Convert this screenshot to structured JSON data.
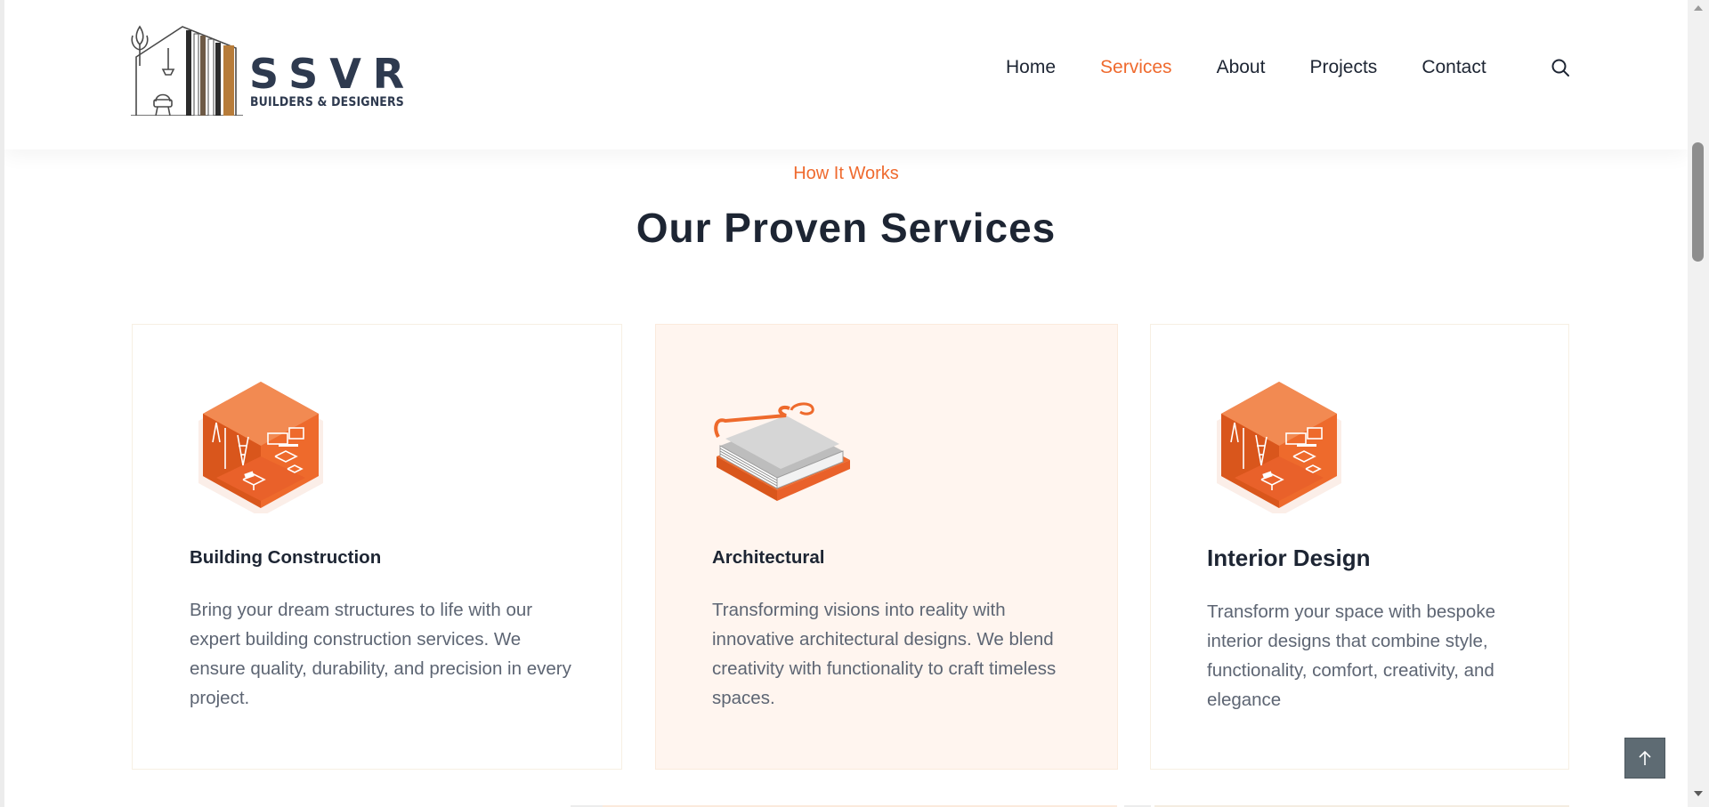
{
  "brand": {
    "name": "SSVR",
    "tagline": "BUILDERS & DESIGNERS",
    "colors": {
      "accent": "#ef6a2e",
      "text": "#1d2533",
      "muted": "#5d6573",
      "highlight_bg": "#fff5ef",
      "logo_brown": "#b77c3a"
    }
  },
  "nav": {
    "items": [
      {
        "label": "Home",
        "active": false
      },
      {
        "label": "Services",
        "active": true
      },
      {
        "label": "About",
        "active": false
      },
      {
        "label": "Projects",
        "active": false
      },
      {
        "label": "Contact",
        "active": false
      }
    ],
    "search_icon": "search-icon"
  },
  "section": {
    "eyebrow": "How It Works",
    "title": "Our Proven Services"
  },
  "services": [
    {
      "title": "Building Construction",
      "description": "Bring your dream structures to life with our expert building construction services. We ensure quality, durability, and precision in every project.",
      "icon": "isometric-room-construction-icon"
    },
    {
      "title": "Architectural",
      "description": "Transforming visions into reality with innovative architectural designs. We blend creativity with functionality to craft timeless spaces.",
      "icon": "blueprint-stack-icon",
      "highlighted": true
    },
    {
      "title": "Interior Design",
      "description": "Transform your space with bespoke interior designs that combine style, functionality, comfort, creativity, and elegance",
      "icon": "isometric-room-interior-icon"
    }
  ],
  "back_to_top": {
    "icon": "arrow-up-icon"
  }
}
